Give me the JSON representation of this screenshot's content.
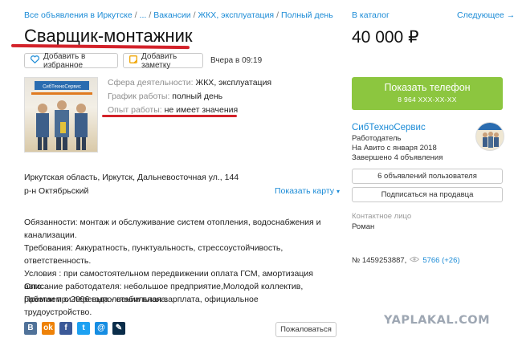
{
  "breadcrumb": {
    "items": [
      "Все объявления в Иркутске",
      "...",
      "Вакансии",
      "ЖКХ, эксплуатация",
      "Полный день"
    ],
    "separator": "/"
  },
  "nav": {
    "catalog": "В каталог",
    "next": "Следующее →"
  },
  "listing": {
    "title": "Сварщик-монтажник",
    "price": "40 000 ₽",
    "favorite_label": "Добавить в избранное",
    "note_label": "Добавить заметку",
    "date": "Вчера в 09:19",
    "params": [
      {
        "key": "Сфера деятельности:",
        "value": "ЖКХ, эксплуатация"
      },
      {
        "key": "График работы:",
        "value": "полный день"
      },
      {
        "key": "Опыт работы:",
        "value": "не имеет значения"
      }
    ],
    "address": "Иркутская область, Иркутск, Дальневосточная ул., 144",
    "district": "р-н Октябрьский",
    "map_link": "Показать карту",
    "description_1": "Обязанности: монтаж и обслуживание систем отопления, водоснабжения и канализации.\nТребования: Аккуратность, пунктуальность, стрессоустойчивость, ответственность.\nУсловия : при самостоятельном передвижении оплата ГСМ, амортизация авто.\nПремии при перевыполнении плана.",
    "description_2": "Описание работодателя: небольшое предприятие,Молодой коллектив, работаем с 2006 года - стабильная зарплата, официальное трудоустройство.",
    "report_label": "Пожаловаться"
  },
  "sidebar": {
    "phone_label": "Показать телефон",
    "phone_number": "8 964 XXX-XX-XX",
    "seller_name": "СибТехноСервис",
    "seller_role": "Работодатель",
    "seller_since": "На Авито с января 2018",
    "seller_done": "Завершено 4 объявления",
    "user_ads": "6 объявлений пользователя",
    "subscribe": "Подписаться на продавца",
    "contact_label": "Контактное лицо",
    "contact_name": "Роман",
    "ad_number": "№ 1459253887,",
    "views": "5766 (+26)"
  },
  "social": {
    "vk": "В",
    "ok": "ok",
    "fb": "f",
    "tw": "t",
    "mail": "@",
    "lj": "✎"
  },
  "photo_caption": "СибТехноСервис",
  "watermark": "YAPLAKAL.COM",
  "colors": {
    "link": "#1b8bd6",
    "phone_button": "#8cc63f",
    "annotation_red": "#d3222a"
  },
  "icons": [
    "heart-icon",
    "note-icon",
    "chevron-down-icon",
    "eye-icon"
  ]
}
